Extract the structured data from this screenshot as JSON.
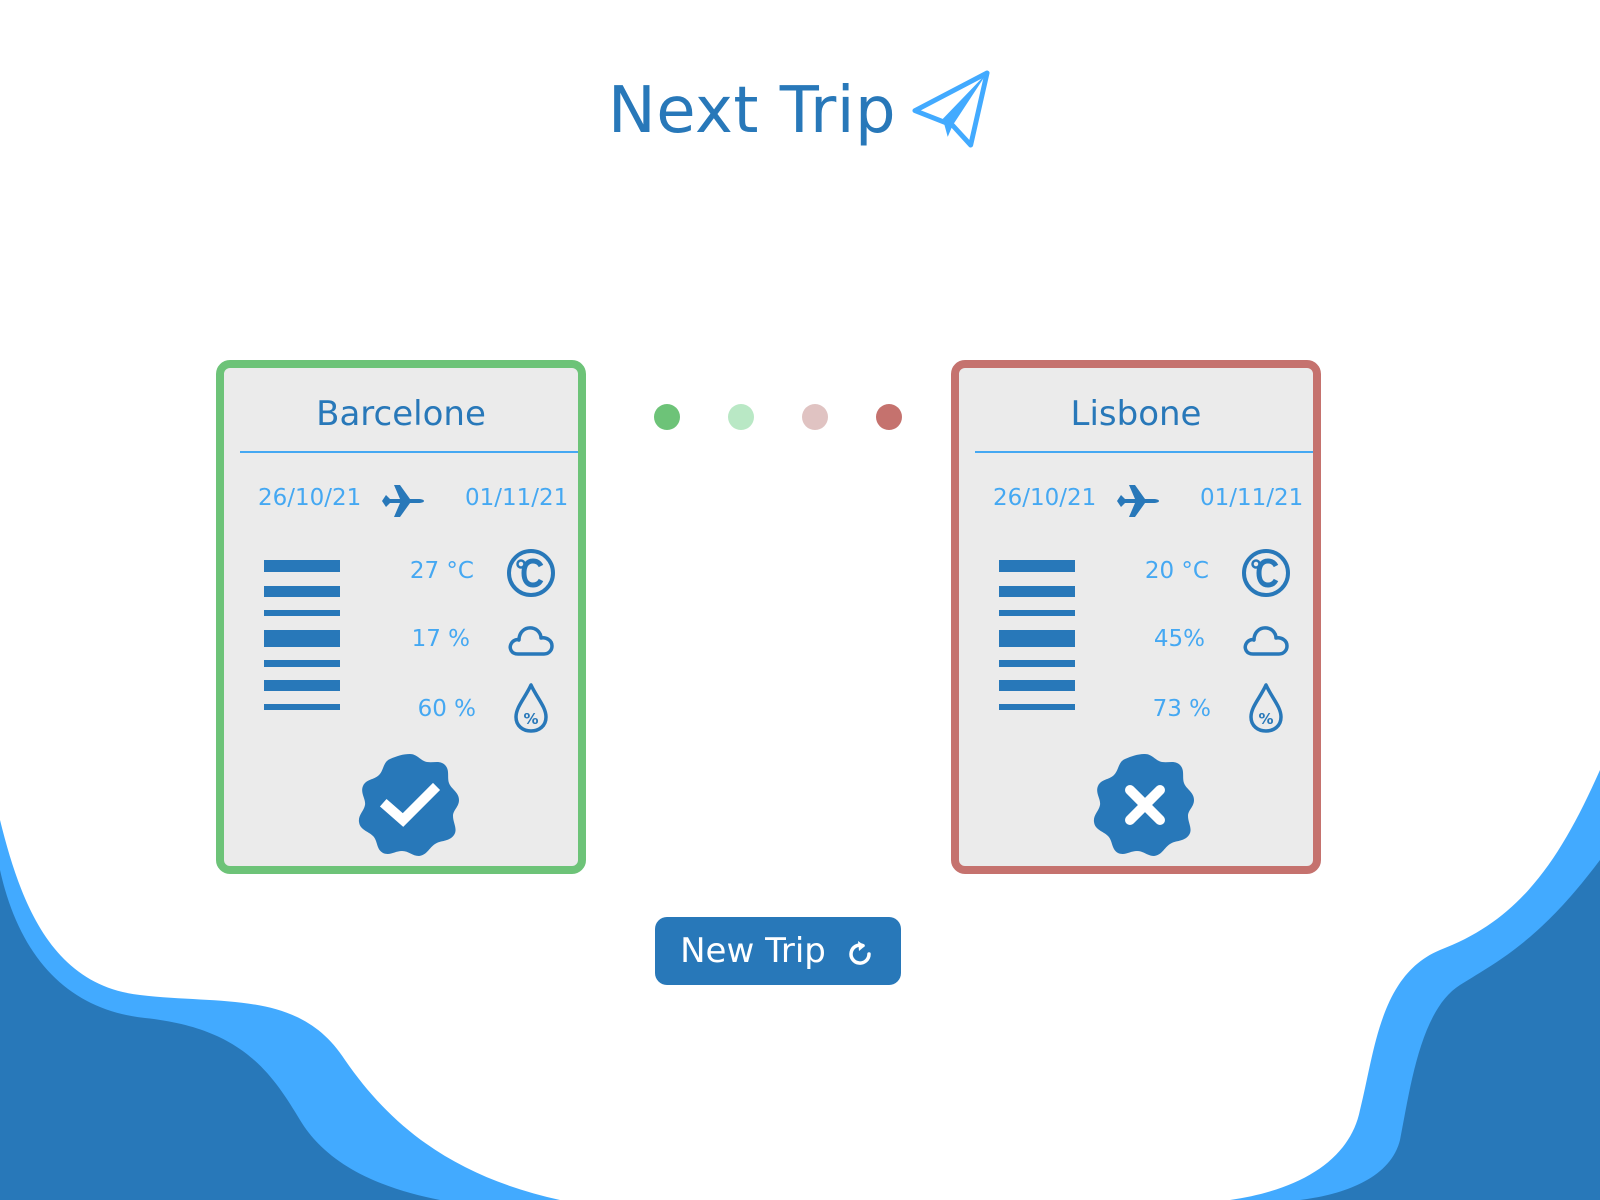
{
  "app": {
    "title": "Next Trip",
    "new_trip_label": "New Trip"
  },
  "colors": {
    "primary": "#2878b9",
    "light_blue": "#45a8f2",
    "accept": "#6dc378",
    "reject": "#c5726e",
    "card_bg": "#ebebeb"
  },
  "indicator_dots": [
    "#6dc378",
    "#b9e8c5",
    "#e0c3c2",
    "#c5726e"
  ],
  "trips": [
    {
      "destination": "Barcelone",
      "depart_date": "26/10/21",
      "return_date": "01/11/21",
      "temperature": "27 °C",
      "cloud_cover": "17 %",
      "humidity": "60 %",
      "verdict": "accepted",
      "verdict_icon": "check-badge-icon"
    },
    {
      "destination": "Lisbone",
      "depart_date": "26/10/21",
      "return_date": "01/11/21",
      "temperature": "20 °C",
      "cloud_cover": "45%",
      "humidity": "73 %",
      "verdict": "rejected",
      "verdict_icon": "cross-badge-icon"
    }
  ]
}
